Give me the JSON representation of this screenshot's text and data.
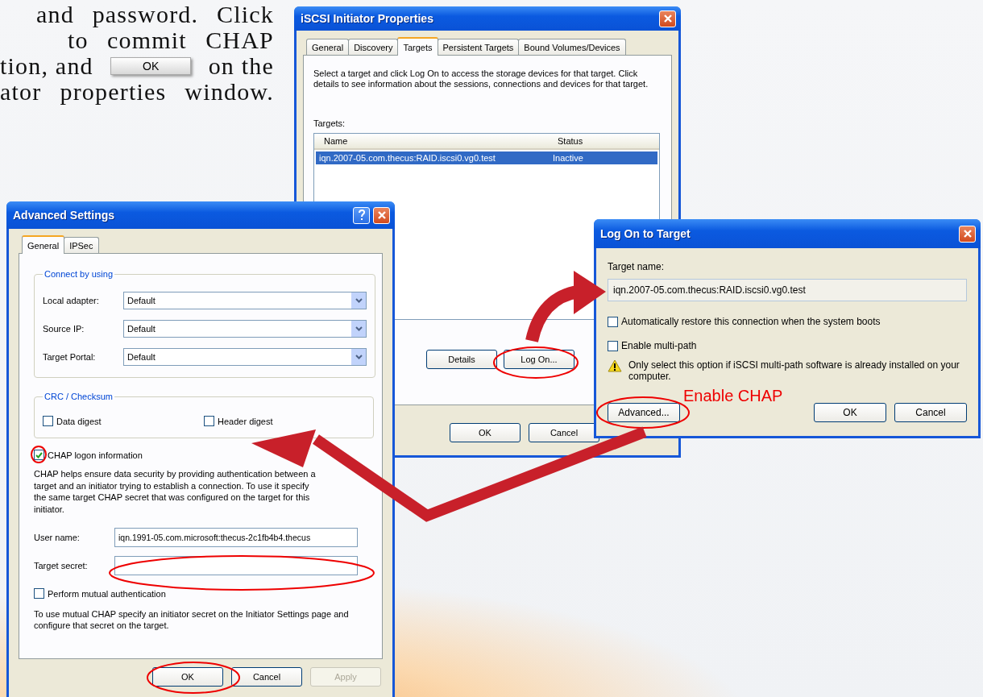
{
  "intro_lines": [
    {
      "parts": [
        {
          "kind": "text",
          "text": "and password. Click"
        }
      ]
    },
    {
      "parts": [
        {
          "kind": "text",
          "text": "to commit CHAP"
        }
      ]
    },
    {
      "parts": [
        {
          "kind": "text",
          "text": "tion, and"
        },
        {
          "kind": "button",
          "text": "OK"
        },
        {
          "kind": "text",
          "text": "on the"
        }
      ]
    },
    {
      "parts": [
        {
          "kind": "text",
          "text": "ator properties window."
        }
      ]
    }
  ],
  "iscsi_window": {
    "title": "iSCSI Initiator Properties",
    "tabs": [
      {
        "label": "General",
        "selected": false
      },
      {
        "label": "Discovery",
        "selected": false
      },
      {
        "label": "Targets",
        "selected": true
      },
      {
        "label": "Persistent Targets",
        "selected": false
      },
      {
        "label": "Bound Volumes/Devices",
        "selected": false
      }
    ],
    "description": "Select a target and click Log On to access the storage devices for that target. Click details to see information about the sessions, connections and devices for that target.",
    "targets_label": "Targets:",
    "columns": [
      "Name",
      "Status"
    ],
    "rows": [
      {
        "cells": [
          "iqn.2007-05.com.thecus:RAID.iscsi0.vg0.test",
          "Inactive"
        ],
        "selected": true
      }
    ],
    "buttons": [
      "Details",
      "Log On..."
    ],
    "footer_buttons": [
      "OK",
      "Cancel"
    ]
  },
  "advanced_window": {
    "title": "Advanced Settings",
    "tabs": [
      {
        "label": "General",
        "selected": true
      },
      {
        "label": "IPSec",
        "selected": false
      }
    ],
    "connect_group": {
      "legend": "Connect by using",
      "rows": [
        {
          "label": "Local adapter:",
          "value": "Default"
        },
        {
          "label": "Source IP:",
          "value": "Default"
        },
        {
          "label": "Target Portal:",
          "value": "Default"
        }
      ]
    },
    "checksum_group": {
      "legend": "CRC / Checksum",
      "options": [
        {
          "label": "Data digest",
          "checked": false
        },
        {
          "label": "Header digest",
          "checked": false
        }
      ]
    },
    "chap": {
      "label": "CHAP logon information",
      "checked": true
    },
    "chap_description": "CHAP helps ensure data security by providing authentication between a target and an initiator trying to establish a connection. To use it specify the same target CHAP secret that was configured on the target for this initiator.",
    "fields": [
      {
        "label": "User name:",
        "value": "iqn.1991-05.com.microsoft:thecus-2c1fb4b4.thecus"
      },
      {
        "label": "Target secret:"
      }
    ],
    "mutual": {
      "label": "Perform mutual authentication",
      "checked": false
    },
    "mutual_note": "To use mutual CHAP specify an initiator secret on the Initiator Settings page and configure that secret on the target.",
    "buttons": [
      {
        "label": "OK",
        "disabled": false
      },
      {
        "label": "Cancel",
        "disabled": false
      },
      {
        "label": "Apply",
        "disabled": true
      }
    ]
  },
  "logon_window": {
    "title": "Log On to Target",
    "target_label": "Target name:",
    "target_value": "iqn.2007-05.com.thecus:RAID.iscsi0.vg0.test",
    "options": [
      {
        "label": "Automatically restore this connection when the system boots",
        "checked": false
      },
      {
        "label": "Enable multi-path",
        "checked": false
      }
    ],
    "warning": "Only select this option if iSCSI multi-path software is already installed on your computer.",
    "advanced_button": "Advanced...",
    "buttons": [
      "OK",
      "Cancel"
    ]
  },
  "annotation": "Enable CHAP"
}
